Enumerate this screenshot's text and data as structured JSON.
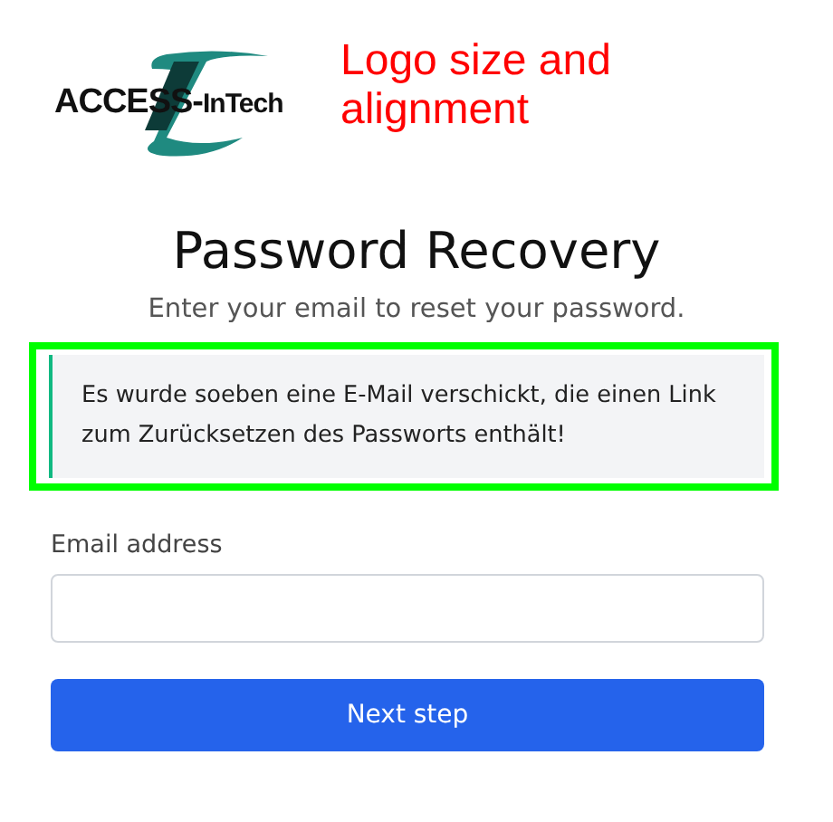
{
  "logo": {
    "text_left": "ACCESS-",
    "text_right": "InTech"
  },
  "annotation": {
    "text": "Logo size and alignment",
    "color": "#ff0000"
  },
  "heading": "Password Recovery",
  "subtitle": "Enter your email to reset your password.",
  "highlight": {
    "color": "#00ff00"
  },
  "alert": {
    "text": "Es wurde soeben eine E-Mail verschickt, die einen Link zum Zurücksetzen des Passworts enthält!"
  },
  "email_field": {
    "label": "Email address"
  },
  "submit_button": {
    "label": "Next step"
  }
}
